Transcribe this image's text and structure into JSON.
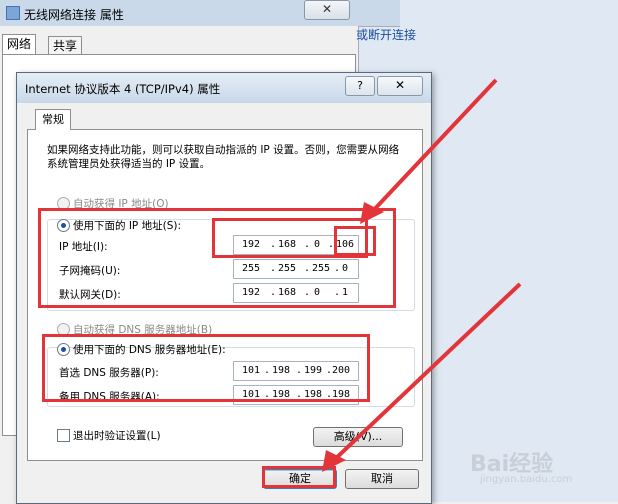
{
  "back_window": {
    "title": "无线网络连接 属性",
    "close": "✕",
    "tabs": [
      "网络",
      "共享"
    ],
    "link": "或断开连接"
  },
  "dialog": {
    "title": "Internet 协议版本 4 (TCP/IPv4) 属性",
    "help": "?",
    "close": "✕",
    "tab": "常规",
    "description": "如果网络支持此功能，则可以获取自动指派的 IP 设置。否则，您需要从网络系统管理员处获得适当的 IP 设置。",
    "auto_ip_label": "自动获得 IP 地址(O)",
    "manual_ip_label": "使用下面的 IP 地址(S):",
    "ip_label": "IP 地址(I):",
    "subnet_label": "子网掩码(U):",
    "gateway_label": "默认网关(D):",
    "ip": [
      "192",
      "168",
      "0",
      "106"
    ],
    "subnet": [
      "255",
      "255",
      "255",
      "0"
    ],
    "gateway": [
      "192",
      "168",
      "0",
      "1"
    ],
    "auto_dns_label": "自动获得 DNS 服务器地址(B)",
    "manual_dns_label": "使用下面的 DNS 服务器地址(E):",
    "preferred_dns_label": "首选 DNS 服务器(P):",
    "alternate_dns_label": "备用 DNS 服务器(A):",
    "preferred_dns": [
      "101",
      "198",
      "199",
      "200"
    ],
    "alternate_dns": [
      "101",
      "198",
      "198",
      "198"
    ],
    "validate_label": "退出时验证设置(L)",
    "advanced_button": "高级(V)...",
    "ok_button": "确定",
    "cancel_button": "取消"
  },
  "watermark": "Bai经验",
  "watermark_sub": "jingyan.baidu.com",
  "colors": {
    "highlight": "#e3343a",
    "accent": "#1c4fa8"
  }
}
